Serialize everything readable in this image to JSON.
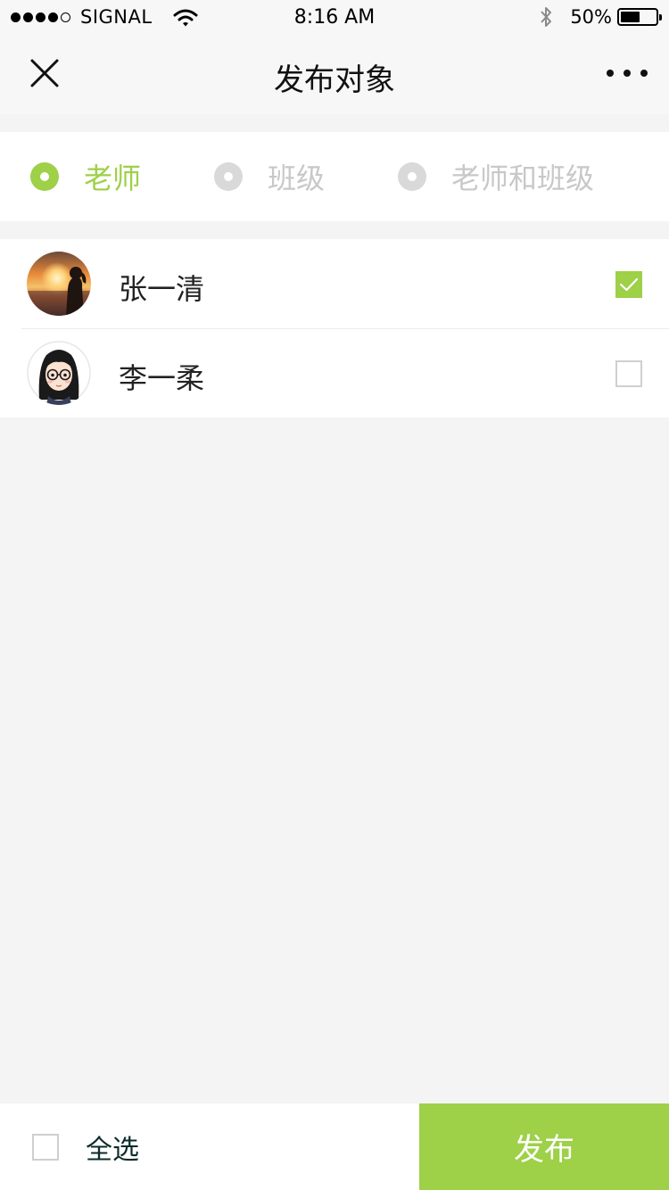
{
  "status_bar": {
    "carrier": "SIGNAL",
    "signal_strength": 4,
    "signal_max": 5,
    "time": "8:16 AM",
    "battery": "50%",
    "battery_level": 0.5
  },
  "nav": {
    "title": "发布对象",
    "close_icon": "close-icon",
    "more_icon": "more-icon"
  },
  "target_types": {
    "selected_index": 0,
    "options": [
      {
        "label": "老师"
      },
      {
        "label": "班级"
      },
      {
        "label": "老师和班级"
      }
    ]
  },
  "teachers": [
    {
      "name": "张一清",
      "checked": true,
      "avatar": "sunset-photo-avatar"
    },
    {
      "name": "李一柔",
      "checked": false,
      "avatar": "cartoon-girl-avatar"
    }
  ],
  "footer": {
    "select_all_label": "全选",
    "select_all_checked": false,
    "publish_label": "发布"
  },
  "colors": {
    "accent": "#9ed048",
    "inactive": "#d9d9d9",
    "inactive_text": "#c8c8c8",
    "checkbox_border": "#cfcfcf"
  }
}
